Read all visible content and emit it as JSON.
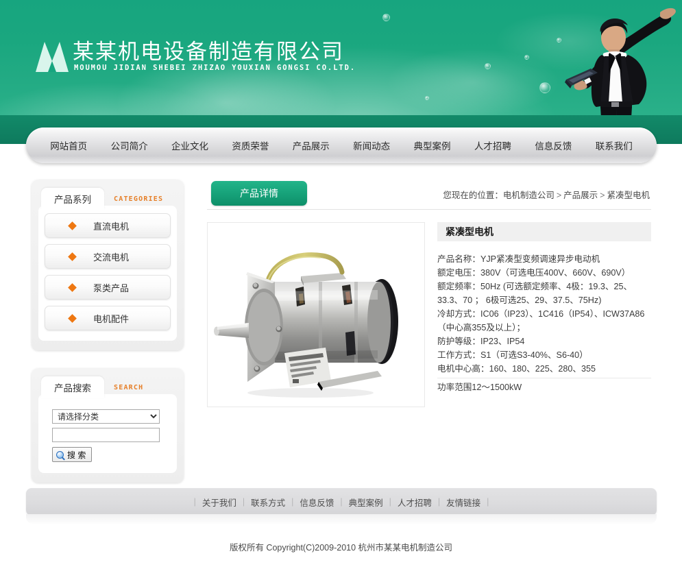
{
  "header": {
    "logo_icon": "mountain-m-logo",
    "company_name": "某某机电设备制造有限公司",
    "company_pinyin": "MOUMOU JIDIAN SHEBEI ZHIZAO YOUXIAN GONGSI CO.LTD.",
    "hero_image": "businessman-with-laptop",
    "accent_color": "#17a57f"
  },
  "nav": {
    "items": [
      {
        "label": "网站首页"
      },
      {
        "label": "公司简介"
      },
      {
        "label": "企业文化"
      },
      {
        "label": "资质荣誉"
      },
      {
        "label": "产品展示"
      },
      {
        "label": "新闻动态"
      },
      {
        "label": "典型案例"
      },
      {
        "label": "人才招聘"
      },
      {
        "label": "信息反馈"
      },
      {
        "label": "联系我们"
      }
    ]
  },
  "sidebar": {
    "categories_panel": {
      "tab_label": "产品系列",
      "en_label": "CATEGORIES",
      "bullet_icon": "orange-diamond-icon",
      "bullet_color": "#ee7711",
      "items": [
        {
          "label": "直流电机"
        },
        {
          "label": "交流电机"
        },
        {
          "label": "泵类产品"
        },
        {
          "label": "电机配件"
        }
      ]
    },
    "search_panel": {
      "tab_label": "产品搜索",
      "en_label": "SEARCH",
      "select_value": "请选择分类",
      "select_options": [
        "请选择分类"
      ],
      "keyword_value": "",
      "keyword_placeholder": "",
      "button_label": "搜 索",
      "button_icon": "magnifier-icon"
    }
  },
  "main": {
    "tab_label": "产品详情",
    "breadcrumb": {
      "prefix": "您现在的位置：",
      "items": [
        "电机制造公司",
        "产品展示",
        "紧凑型电机"
      ],
      "separator": ">"
    },
    "product": {
      "image_alt": "紧凑型电机产品图片",
      "title": "紧凑型电机",
      "spec_lines": [
        "产品名称：YJP紧凑型变频调速异步电动机",
        "额定电压：380V（可选电压400V、660V、690V）",
        "额定频率：50Hz (可选额定频率、4极：19.3、25、33.3、70 ； 6极可选25、29、37.5、75Hz)",
        "冷却方式：IC06（IP23）、1C416（IP54）、ICW37A86（中心高355及以上）；",
        "防护等级：IP23、IP54",
        "工作方式：S1（可选S3-40%、S6-40）",
        "电机中心高：160、180、225、280、355"
      ],
      "spec_last_line": "功率范围12～1500kW"
    }
  },
  "footer": {
    "links": [
      {
        "label": "关于我们"
      },
      {
        "label": "联系方式"
      },
      {
        "label": "信息反馈"
      },
      {
        "label": "典型案例"
      },
      {
        "label": "人才招聘"
      },
      {
        "label": "友情链接"
      }
    ],
    "copyright": "版权所有  Copyright(C)2009-2010 杭州市某某电机制造公司"
  }
}
